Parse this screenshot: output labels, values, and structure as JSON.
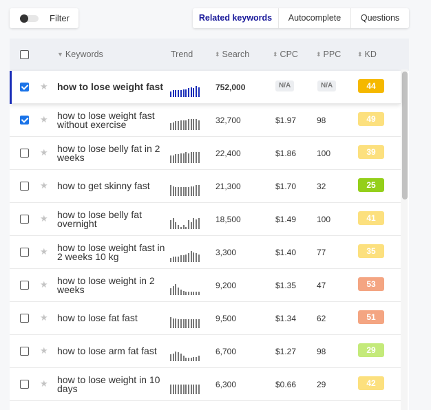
{
  "toolbar": {
    "filter_label": "Filter",
    "tabs": [
      {
        "label": "Related keywords",
        "active": true
      },
      {
        "label": "Autocomplete",
        "active": false
      },
      {
        "label": "Questions",
        "active": false
      }
    ]
  },
  "table": {
    "headers": {
      "keywords": "Keywords",
      "trend": "Trend",
      "search": "Search",
      "cpc": "CPC",
      "ppc": "PPC",
      "kd": "KD"
    },
    "rows": [
      {
        "checked": true,
        "keyword": "how to lose weight fast",
        "search": "752,000",
        "cpc": "N/A",
        "ppc": "N/A",
        "kd": "44",
        "kd_color": "#f5b800",
        "trend": [
          5,
          6,
          6,
          6,
          6,
          7,
          7,
          8,
          9,
          8,
          10,
          9
        ],
        "bold": true
      },
      {
        "checked": true,
        "keyword": "how to lose weight fast without exercise",
        "search": "32,700",
        "cpc": "$1.97",
        "ppc": "98",
        "kd": "49",
        "kd_color": "#fce07e",
        "trend": [
          6,
          7,
          8,
          8,
          9,
          9,
          9,
          10,
          10,
          10,
          10,
          9
        ],
        "bold": false
      },
      {
        "checked": false,
        "keyword": "how to lose belly fat in 2 weeks",
        "search": "22,400",
        "cpc": "$1.86",
        "ppc": "100",
        "kd": "39",
        "kd_color": "#fce07e",
        "trend": [
          7,
          7,
          8,
          8,
          9,
          9,
          10,
          9,
          10,
          10,
          10,
          10
        ],
        "bold": false
      },
      {
        "checked": false,
        "keyword": "how to get skinny fast",
        "search": "21,300",
        "cpc": "$1.70",
        "ppc": "32",
        "kd": "25",
        "kd_color": "#94cf1a",
        "trend": [
          10,
          9,
          8,
          8,
          8,
          8,
          8,
          8,
          9,
          9,
          10,
          10
        ],
        "bold": false
      },
      {
        "checked": false,
        "keyword": "how to lose belly fat overnight",
        "search": "18,500",
        "cpc": "$1.49",
        "ppc": "100",
        "kd": "41",
        "kd_color": "#fce07e",
        "trend": [
          8,
          10,
          6,
          4,
          2,
          4,
          2,
          8,
          6,
          10,
          9,
          10
        ],
        "bold": false
      },
      {
        "checked": false,
        "keyword": "how to lose weight fast in 2 weeks 10 kg",
        "search": "3,300",
        "cpc": "$1.40",
        "ppc": "77",
        "kd": "35",
        "kd_color": "#fce07e",
        "trend": [
          4,
          5,
          5,
          5,
          6,
          6,
          7,
          8,
          10,
          9,
          8,
          7
        ],
        "bold": false
      },
      {
        "checked": false,
        "keyword": "how to lose weight in 2 weeks",
        "search": "9,200",
        "cpc": "$1.35",
        "ppc": "47",
        "kd": "53",
        "kd_color": "#f4a582",
        "trend": [
          6,
          8,
          10,
          7,
          5,
          4,
          3,
          3,
          3,
          3,
          3,
          3
        ],
        "bold": false
      },
      {
        "checked": false,
        "keyword": "how to lose fat fast",
        "search": "9,500",
        "cpc": "$1.34",
        "ppc": "62",
        "kd": "51",
        "kd_color": "#f4a582",
        "trend": [
          10,
          9,
          9,
          8,
          8,
          8,
          8,
          8,
          8,
          8,
          8,
          8
        ],
        "bold": false
      },
      {
        "checked": false,
        "keyword": "how to lose arm fat fast",
        "search": "6,700",
        "cpc": "$1.27",
        "ppc": "98",
        "kd": "29",
        "kd_color": "#c4ea7a",
        "trend": [
          6,
          7,
          9,
          8,
          7,
          5,
          3,
          3,
          3,
          4,
          4,
          5
        ],
        "bold": false
      },
      {
        "checked": false,
        "keyword": "how to lose weight in 10 days",
        "search": "6,300",
        "cpc": "$0.66",
        "ppc": "29",
        "kd": "42",
        "kd_color": "#fce07e",
        "trend": [
          9,
          9,
          9,
          9,
          9,
          9,
          9,
          9,
          9,
          9,
          9,
          9
        ],
        "bold": false
      }
    ]
  }
}
